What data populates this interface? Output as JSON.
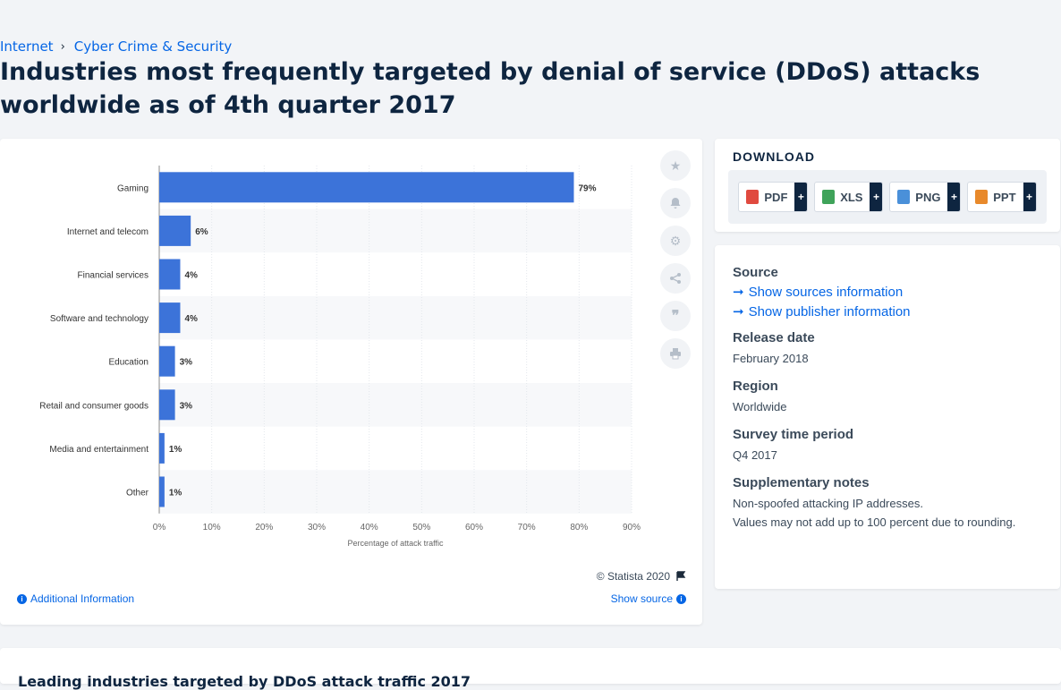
{
  "breadcrumb": {
    "item1": "Internet",
    "item2": "Cyber Crime & Security",
    "separator": "›"
  },
  "title": "Industries most frequently targeted by denial of service (DDoS) attacks worldwide as of 4th quarter 2017",
  "chart_data": {
    "type": "bar",
    "orientation": "horizontal",
    "categories": [
      "Gaming",
      "Internet and telecom",
      "Financial services",
      "Software and technology",
      "Education",
      "Retail and consumer goods",
      "Media and entertainment",
      "Other"
    ],
    "values": [
      79,
      6,
      4,
      4,
      3,
      3,
      1,
      1
    ],
    "value_labels": [
      "79%",
      "6%",
      "4%",
      "4%",
      "3%",
      "3%",
      "1%",
      "1%"
    ],
    "xlabel": "Percentage of attack traffic",
    "xticks": [
      "0%",
      "10%",
      "20%",
      "30%",
      "40%",
      "50%",
      "60%",
      "70%",
      "80%",
      "90%"
    ],
    "xlim": [
      0,
      90
    ],
    "bar_color": "#3c73d9",
    "grid": true
  },
  "chart_footer": {
    "copyright": "© Statista 2020",
    "additional_info": "Additional Information",
    "show_source": "Show source"
  },
  "download": {
    "title": "DOWNLOAD",
    "formats": [
      {
        "label": "PDF",
        "color": "#e04a3f"
      },
      {
        "label": "XLS",
        "color": "#3fa35a"
      },
      {
        "label": "PNG",
        "color": "#4a90d9"
      },
      {
        "label": "PPT",
        "color": "#e8892b"
      }
    ],
    "plus": "+"
  },
  "meta": {
    "source_heading": "Source",
    "show_sources": "Show sources information",
    "show_publisher": "Show publisher information",
    "release_heading": "Release date",
    "release_value": "February 2018",
    "region_heading": "Region",
    "region_value": "Worldwide",
    "survey_heading": "Survey time period",
    "survey_value": "Q4 2017",
    "notes_heading": "Supplementary notes",
    "notes_line1": "Non-spoofed attacking IP addresses.",
    "notes_line2": "Values may not add up to 100 percent due to rounding."
  },
  "bottom": {
    "title": "Leading industries targeted by DDoS attack traffic 2017"
  },
  "icons": {
    "star": "star-icon",
    "bell": "bell-icon",
    "gear": "gear-icon",
    "share": "share-icon",
    "quote": "quote-icon",
    "print": "print-icon"
  }
}
